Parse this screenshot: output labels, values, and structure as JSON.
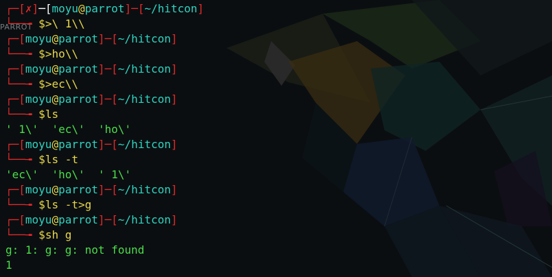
{
  "wallpaper": {
    "label": "PARROT"
  },
  "prompt": {
    "error_mark": "✗",
    "user": "moyu",
    "at": "@",
    "host": "parrot",
    "path": "~/hitcon",
    "dollar": "$"
  },
  "session": [
    {
      "cmd": ">\\ 1\\\\",
      "error": true,
      "output": []
    },
    {
      "cmd": ">ho\\\\",
      "error": false,
      "output": []
    },
    {
      "cmd": ">ec\\\\",
      "error": false,
      "output": []
    },
    {
      "cmd": "ls",
      "error": false,
      "output": [
        "' 1\\'  'ec\\'  'ho\\'"
      ]
    },
    {
      "cmd": "ls -t",
      "error": false,
      "output": [
        "'ec\\'  'ho\\'  ' 1\\'"
      ]
    },
    {
      "cmd": "ls -t>g",
      "error": false,
      "output": []
    },
    {
      "cmd": "sh g",
      "error": false,
      "output": [
        "g: 1: g: g: not found",
        "1"
      ]
    }
  ],
  "colors": {
    "bracket": "#e02a2a",
    "user_host_path": "#2fd4c0",
    "at_dollar_cmd": "#e8d84a",
    "output": "#4adf4a",
    "background": "#0b0e11"
  }
}
